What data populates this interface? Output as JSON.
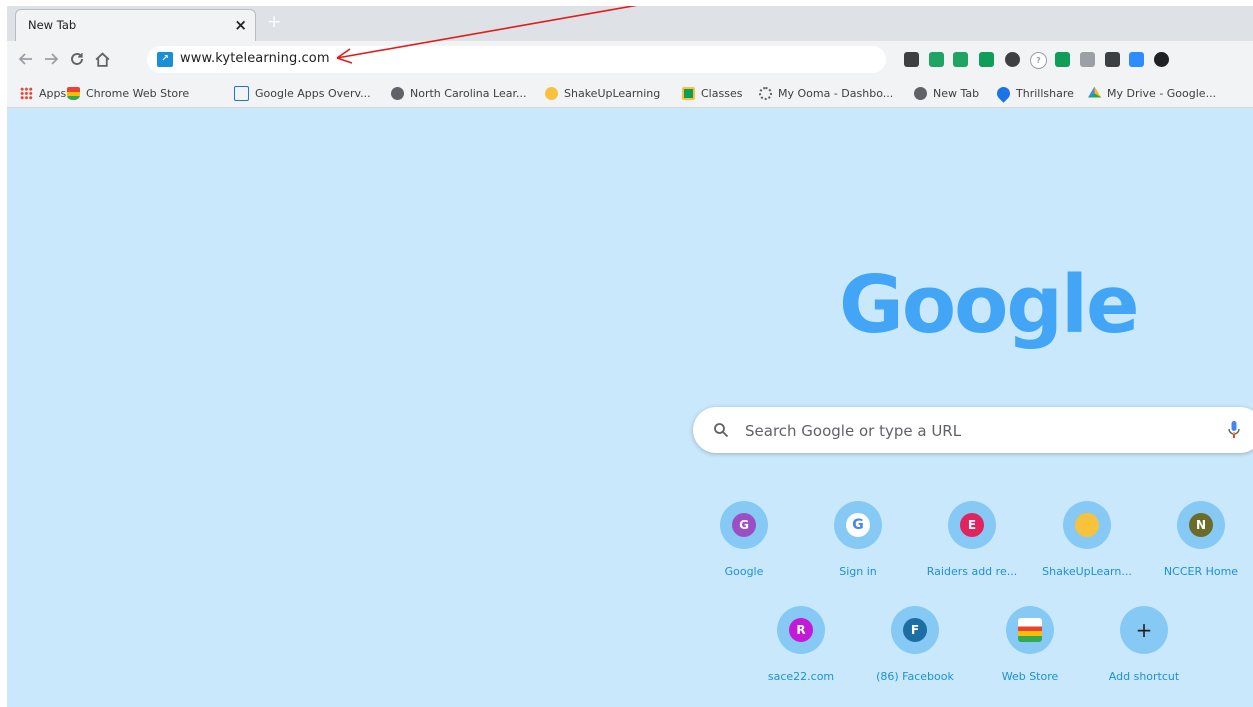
{
  "tab": {
    "title": "New Tab",
    "close_glyph": "×",
    "new_tab_glyph": "+"
  },
  "toolbar": {
    "url": "www.kytelearning.com",
    "site_icon": "kytelearning-favicon",
    "extensions": [
      {
        "icon": "eyedropper-icon",
        "color": "#3c4043"
      },
      {
        "icon": "google-drive-icon",
        "color": "#1fa463"
      },
      {
        "icon": "location-icon",
        "color": "#1fa463"
      },
      {
        "icon": "puzzle-extension-icon",
        "color": "#0f9d58"
      },
      {
        "icon": "compass-icon",
        "color": "#3c4043"
      },
      {
        "icon": "help-icon",
        "color": "#9aa0a6"
      },
      {
        "icon": "classroom-icon",
        "color": "#0f9d58"
      },
      {
        "icon": "image-extension-icon",
        "color": "#9aa0a6"
      },
      {
        "icon": "screencast-icon",
        "color": "#3c4043"
      },
      {
        "icon": "zoom-icon",
        "color": "#2d8cff"
      },
      {
        "icon": "dark-circle-icon",
        "color": "#202124"
      }
    ]
  },
  "bookmarks": [
    {
      "label": "Apps",
      "icon": "apps-grid-icon",
      "color": "#ea4335"
    },
    {
      "label": "Chrome Web Store",
      "icon": "web-store-icon",
      "color": "#fbbc05"
    },
    {
      "label": "Google Apps Overv...",
      "icon": "google-sites-icon",
      "color": "#1a73e8"
    },
    {
      "label": "North Carolina Lear...",
      "icon": "globe-icon",
      "color": "#3c4043"
    },
    {
      "label": "ShakeUpLearning",
      "icon": "shakeup-icon",
      "color": "#f9c23c"
    },
    {
      "label": "Classes",
      "icon": "classroom-icon",
      "color": "#0f9d58"
    },
    {
      "label": "My Ooma - Dashbo...",
      "icon": "ooma-icon",
      "color": "#5f6368"
    },
    {
      "label": "New Tab",
      "icon": "globe-icon",
      "color": "#3c4043"
    },
    {
      "label": "Thrillshare",
      "icon": "thrillshare-icon",
      "color": "#1a73e8"
    },
    {
      "label": "My Drive - Google...",
      "icon": "google-drive-icon",
      "color": "#fbbc05"
    }
  ],
  "search": {
    "placeholder": "Search Google or type a URL"
  },
  "logo": {
    "text": "Google"
  },
  "shortcuts": [
    {
      "label": "Google",
      "letter": "G",
      "color": "#9b4fc4"
    },
    {
      "label": "Sign in",
      "letter": "G",
      "color": "#ffffff"
    },
    {
      "label": "Raiders add re...",
      "letter": "E",
      "color": "#e0245e"
    },
    {
      "label": "ShakeUpLearn...",
      "letter": "",
      "color": "#f9c23c"
    },
    {
      "label": "NCCER Home",
      "letter": "N",
      "color": "#6b6b2a"
    },
    {
      "label": "sace22.com",
      "letter": "R",
      "color": "#c21ad6"
    },
    {
      "label": "(86) Facebook",
      "letter": "F",
      "color": "#1d6fa3"
    },
    {
      "label": "Web Store",
      "letter": "",
      "color": "#ffffff"
    },
    {
      "label": "Add shortcut",
      "letter": "+",
      "color": "#86c9f4"
    }
  ]
}
